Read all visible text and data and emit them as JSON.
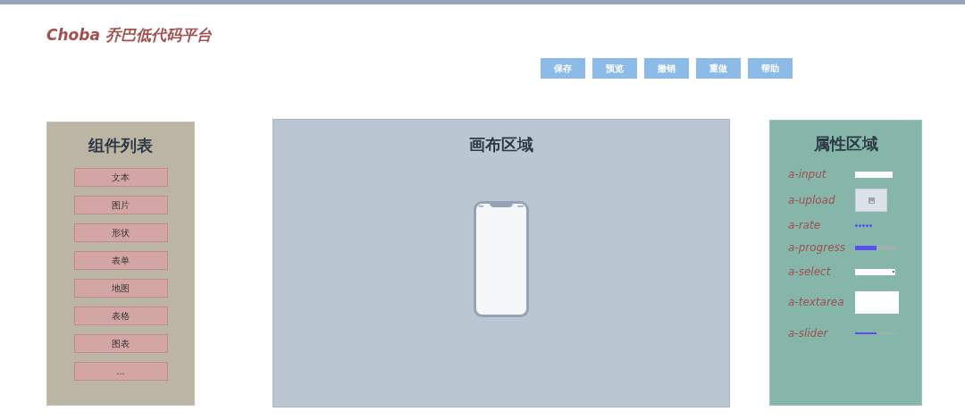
{
  "header": {
    "title": "Choba 乔巴低代码平台"
  },
  "toolbar": {
    "buttons": [
      "保存",
      "预览",
      "撤销",
      "重做",
      "帮助"
    ]
  },
  "component_panel": {
    "title": "组件列表",
    "items": [
      "文本",
      "图片",
      "形状",
      "表单",
      "地图",
      "表格",
      "图表",
      "..."
    ]
  },
  "canvas": {
    "title": "画布区域"
  },
  "property_panel": {
    "title": "属性区域",
    "rows": [
      {
        "label": "a-input",
        "kind": "input"
      },
      {
        "label": "a-upload",
        "kind": "upload"
      },
      {
        "label": "a-rate",
        "kind": "rate",
        "stars": 5
      },
      {
        "label": "a-progress",
        "kind": "progress",
        "level": 0.5
      },
      {
        "label": "a-select",
        "kind": "select"
      },
      {
        "label": "a-textarea",
        "kind": "textarea"
      },
      {
        "label": "a-slider",
        "kind": "slider",
        "level": 0.5
      }
    ]
  }
}
